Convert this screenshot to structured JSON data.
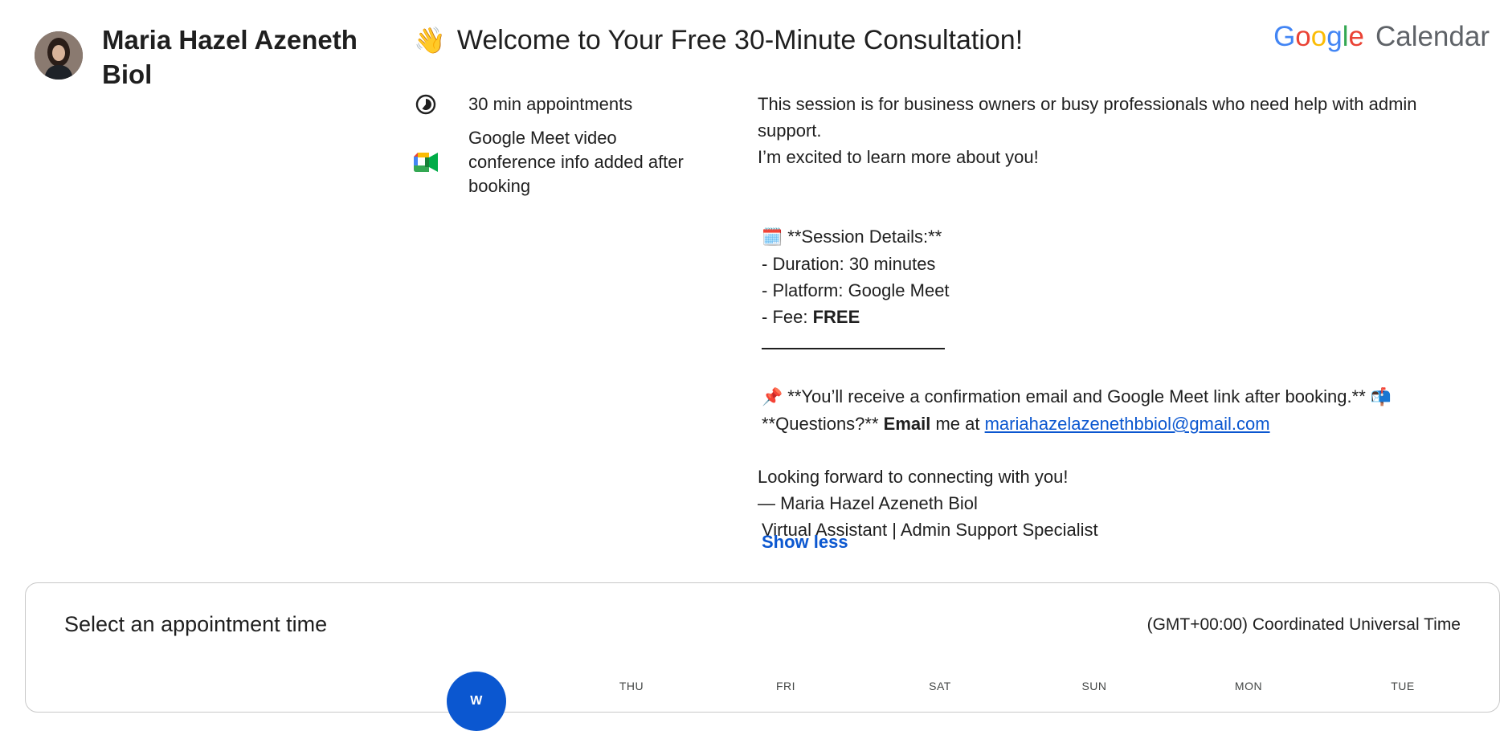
{
  "host": {
    "name": "Maria Hazel Azeneth Biol"
  },
  "header": {
    "wave_emoji": "👋",
    "title": "Welcome to Your Free 30-Minute Consultation!",
    "brand_google": "Google",
    "brand_calendar": "Calendar"
  },
  "meta": {
    "duration": "30 min appointments",
    "conference": "Google Meet video conference info added after booking"
  },
  "description": {
    "intro_1": "This session is for business owners or busy professionals who need help with admin support.",
    "intro_2": "I’m excited to learn more about you!",
    "details_emoji": "🗓️",
    "details_heading": "**Session Details:**",
    "duration_line": "- Duration: 30 minutes",
    "platform_line": "- Platform: Google Meet",
    "fee_label": "- Fee: ",
    "fee_value": "FREE",
    "pin_emoji": "📌",
    "confirmation": "**You’ll receive a confirmation email and Google Meet link after booking.**",
    "mailbox_emoji": "📬",
    "questions_prefix": "**Questions?** ",
    "email_word": "Email",
    "me_at": " me at ",
    "email": "mariahazelazenethbbiol@gmail.com",
    "closing": "Looking forward to connecting with you!",
    "signature": "— Maria Hazel  Azeneth Biol",
    "role": "Virtual Assistant | Admin Support Specialist",
    "show_less": "Show less"
  },
  "booking": {
    "title": "Select an appointment time",
    "timezone": "(GMT+00:00) Coordinated Universal Time",
    "days": [
      "W",
      "THU",
      "FRI",
      "SAT",
      "SUN",
      "MON",
      "TUE"
    ]
  },
  "colors": {
    "accent_blue": "#0b57d0",
    "google_blue": "#4285F4",
    "google_red": "#EA4335",
    "google_yellow": "#FBBC05",
    "google_green": "#34A853"
  }
}
